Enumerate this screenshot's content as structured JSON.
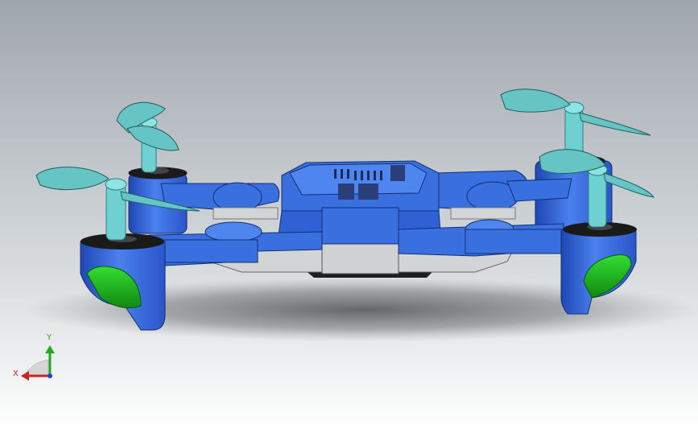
{
  "viewport": {
    "background_top": "#9fa6ad",
    "background_bottom": "#ffffff"
  },
  "model": {
    "body_color": "#3a6fe0",
    "body_dark": "#1f47b4",
    "body_light": "#5a8df0",
    "propeller_color": "#66c4c4",
    "light_gray": "#d2d4d6",
    "foot_color": "#22bb22"
  },
  "triad": {
    "x_label": "X",
    "y_label": "Y",
    "x_color": "#cc2222",
    "y_color": "#22aa22",
    "x_icon": "x-axis-arrow-icon",
    "y_icon": "y-axis-arrow-icon"
  }
}
